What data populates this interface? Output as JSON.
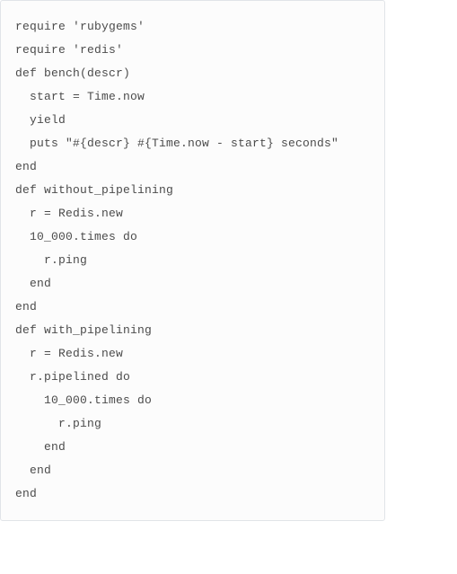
{
  "code": {
    "lines": [
      "require 'rubygems'",
      "require 'redis'",
      "",
      "def bench(descr)",
      "  start = Time.now",
      "  yield",
      "  puts \"#{descr} #{Time.now - start} seconds\"",
      "end",
      "",
      "def without_pipelining",
      "  r = Redis.new",
      "  10_000.times do",
      "    r.ping",
      "  end",
      "end",
      "",
      "def with_pipelining",
      "  r = Redis.new",
      "  r.pipelined do",
      "    10_000.times do",
      "      r.ping",
      "    end",
      "  end",
      "end"
    ]
  }
}
